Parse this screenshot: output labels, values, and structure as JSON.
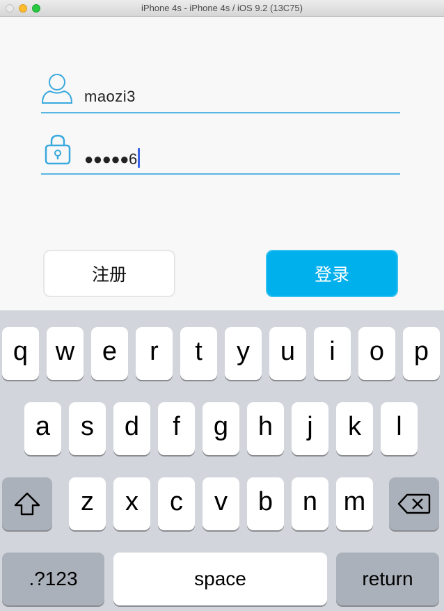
{
  "window": {
    "title": "iPhone 4s - iPhone 4s / iOS 9.2 (13C75)"
  },
  "login": {
    "username_value": "maozi3",
    "password_value": "●●●●●6",
    "register_label": "注册",
    "login_label": "登录",
    "user_icon": "user-icon",
    "lock_icon": "lock-icon"
  },
  "colors": {
    "accent": "#00b0ec",
    "field_line": "#58b6e3",
    "caret": "#3a64e8",
    "keyboard_bg": "#d2d5db"
  },
  "keyboard": {
    "row1": [
      "q",
      "w",
      "e",
      "r",
      "t",
      "y",
      "u",
      "i",
      "o",
      "p"
    ],
    "row2": [
      "a",
      "s",
      "d",
      "f",
      "g",
      "h",
      "j",
      "k",
      "l"
    ],
    "row3": [
      "z",
      "x",
      "c",
      "v",
      "b",
      "n",
      "m"
    ],
    "shift_icon": "shift-icon",
    "delete_icon": "backspace-icon",
    "numbers_label": ".?123",
    "space_label": "space",
    "return_label": "return"
  }
}
